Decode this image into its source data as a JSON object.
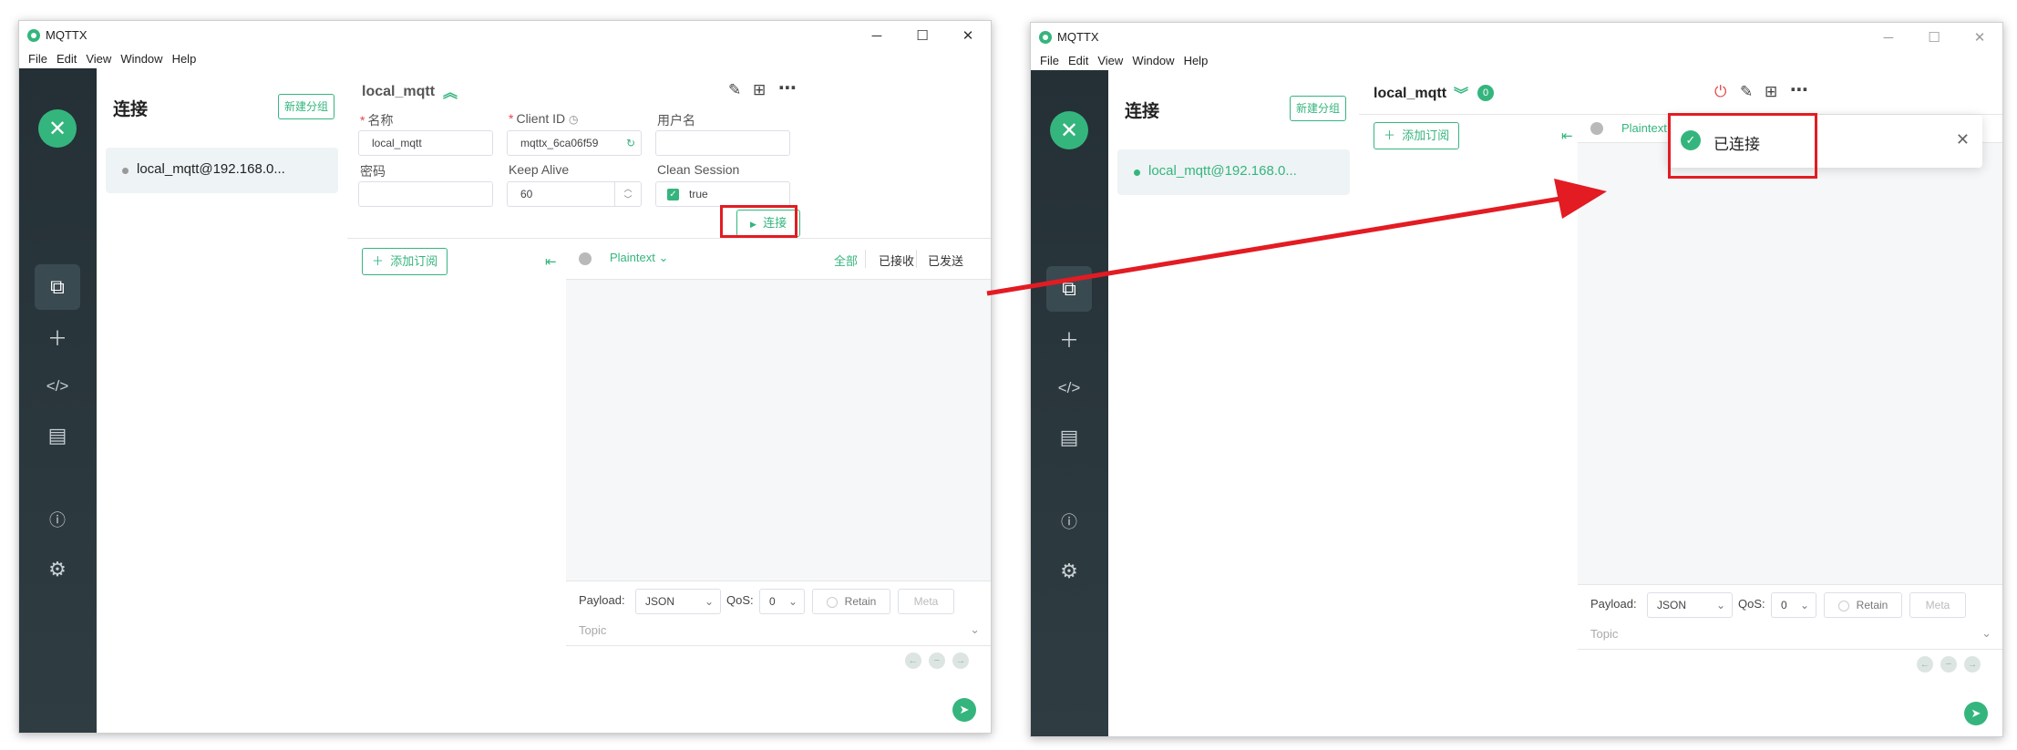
{
  "app": {
    "title": "MQTTX",
    "menu": [
      "File",
      "Edit",
      "View",
      "Window",
      "Help"
    ],
    "accent_color": "#35b57e",
    "highlight_color": "#e31b23"
  },
  "window_controls": {
    "minimize": "─",
    "maximize": "☐",
    "close": "✕"
  },
  "sidebar": {
    "logo_icon": "mqttx-logo-icon",
    "items": [
      "connections-icon",
      "new-connection-icon",
      "script-icon",
      "log-icon",
      "about-icon",
      "settings-icon"
    ]
  },
  "left": {
    "connections": {
      "title": "连接",
      "new_group_label": "新建分组",
      "items": [
        {
          "name": "local_mqtt@192.168.0..."
        }
      ]
    },
    "connection": {
      "name": "local_mqtt",
      "chevron": "︽",
      "fields": {
        "name_label": "名称",
        "name_value": "local_mqtt",
        "client_id_label": "Client ID",
        "client_id_value": "mqttx_6ca06f59",
        "username_label": "用户名",
        "password_label": "密码",
        "keep_alive_label": "Keep Alive",
        "keep_alive_value": "60",
        "clean_session_label": "Clean Session",
        "clean_session_value": "true"
      },
      "connect_label": "连接"
    },
    "subscriptions": {
      "add_label": "添加订阅"
    },
    "messages": {
      "format": "Plaintext",
      "filters": [
        "全部",
        "已接收",
        "已发送"
      ]
    },
    "composer": {
      "payload_label": "Payload:",
      "payload_value": "JSON",
      "qos_label": "QoS:",
      "qos_value": "0",
      "retain_label": "Retain",
      "meta_label": "Meta",
      "topic_placeholder": "Topic"
    }
  },
  "right": {
    "connections": {
      "title": "连接",
      "new_group_label": "新建分组",
      "items": [
        {
          "name": "local_mqtt@192.168.0..."
        }
      ]
    },
    "connection": {
      "name": "local_mqtt",
      "chevron": "︾",
      "badge": "0"
    },
    "subscriptions": {
      "add_label": "添加订阅"
    },
    "messages": {
      "format": "Plaintext"
    },
    "composer": {
      "payload_label": "Payload:",
      "payload_value": "JSON",
      "qos_label": "QoS:",
      "qos_value": "0",
      "retain_label": "Retain",
      "meta_label": "Meta",
      "topic_placeholder": "Topic"
    },
    "toast": {
      "text": "已连接"
    }
  }
}
